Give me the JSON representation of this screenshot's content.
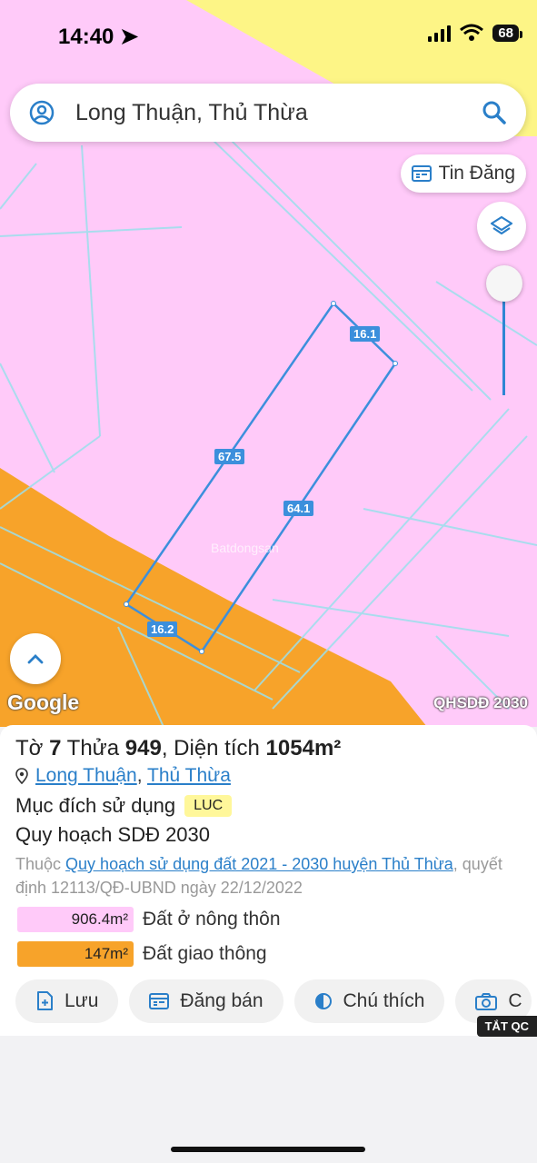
{
  "status_bar": {
    "time": "14:40",
    "battery": "68"
  },
  "search": {
    "query": "Long Thuận, Thủ Thừa"
  },
  "map": {
    "tin_dang_label": "Tin Đăng",
    "google_logo": "Google",
    "layer_tag": "QHSDĐ 2030",
    "watermark": "Batdongsan",
    "dimensions": {
      "top": "16.1",
      "left": "67.5",
      "right": "64.1",
      "bottom": "16.2"
    },
    "colors": {
      "residential": "#ffcaf9",
      "road": "#f7a32a",
      "other": "#fdf586",
      "boundary": "#3c8fdc"
    }
  },
  "parcel": {
    "to_label": "Tờ",
    "to": "7",
    "thua_label": "Thửa",
    "thua": "949",
    "area_label": "Diện tích",
    "area": "1054m²",
    "location_commune": "Long Thuận",
    "location_district": "Thủ Thừa",
    "purpose_label": "Mục đích sử dụng",
    "purpose_code": "LUC",
    "plan_title": "Quy hoạch SDĐ 2030",
    "desc_prefix": "Thuộc",
    "desc_link": "Quy hoạch sử dụng đất 2021 - 2030 huyện Thủ Thừa",
    "desc_suffix": ", quyết định 12113/QĐ-UBND ngày 22/12/2022",
    "areas": [
      {
        "value": "906.4m²",
        "label": "Đất ở nông thôn",
        "color": "#ffcaf9"
      },
      {
        "value": "147m²",
        "label": "Đất giao thông",
        "color": "#f7a32a"
      }
    ]
  },
  "actions": {
    "save": "Lưu",
    "sell": "Đăng bán",
    "legend": "Chú thích",
    "capture": "C"
  },
  "ad_toggle": "TẮT QC"
}
